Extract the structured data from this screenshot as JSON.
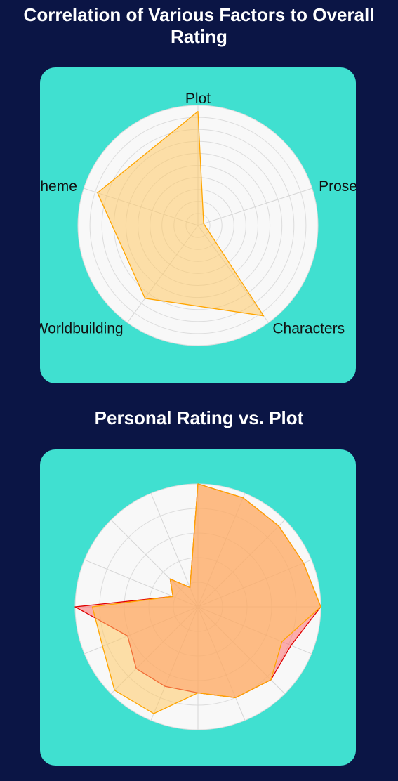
{
  "page": {
    "background": "#0b1545",
    "card_color": "#40e0d0"
  },
  "charts": {
    "radar1": {
      "title": "Correlation of Various Factors to Overall Rating"
    },
    "radar2": {
      "title": "Personal Rating vs. Plot"
    }
  },
  "chart_data": [
    {
      "type": "radar",
      "title": "Correlation of Various Factors to Overall Rating",
      "axes": [
        "Plot",
        "Prose",
        "Characters",
        "Worldbuilding",
        "Theme"
      ],
      "range": [
        0,
        1
      ],
      "gridlines": 10,
      "series": [
        {
          "values": [
            0.95,
            0.05,
            0.93,
            0.75,
            0.88
          ],
          "fill": "rgba(255,200,100,0.55)",
          "stroke": "#ffa500"
        }
      ]
    },
    {
      "type": "radar",
      "title": "Personal Rating vs. Plot",
      "axis_count": 16,
      "range": [
        0,
        10
      ],
      "gridlines": 5,
      "series": [
        {
          "values": [
            10,
            9.6,
            9.3,
            9.3,
            10,
            8.2,
            8.4,
            8.0,
            7.0,
            7.0,
            7.1,
            6.2,
            10,
            2.2,
            3.2,
            1.7
          ],
          "fill": "rgba(255,80,80,0.45)",
          "stroke": "#e00000"
        },
        {
          "values": [
            10,
            9.6,
            9.3,
            9.3,
            10,
            7.4,
            8.4,
            8.0,
            7.0,
            9.4,
            9.6,
            8.4,
            8.6,
            2.2,
            3.2,
            1.7
          ],
          "fill": "rgba(255,200,100,0.55)",
          "stroke": "#ffa500"
        }
      ]
    }
  ]
}
